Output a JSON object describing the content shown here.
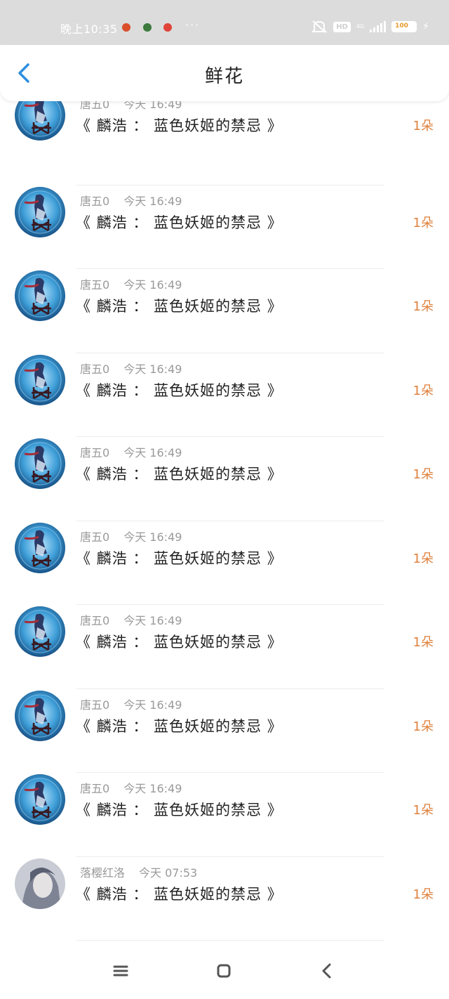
{
  "status_bar": {
    "time": "晚上10:35",
    "more": "···",
    "hd": "HD",
    "network": "4G",
    "battery": "100",
    "notification_colors": [
      "#d9502b",
      "#3c7a3e",
      "#e0443a"
    ]
  },
  "header": {
    "title": "鲜花",
    "back_icon": "chevron-left-icon",
    "accent_color": "#2f8ee0"
  },
  "entries": [
    {
      "user": "唐五0",
      "time": "今天 16:49",
      "book": "《 麟浩 ： 蓝色妖姬的禁忌 》",
      "count": "1朵",
      "avatar": "blue-swordsman"
    },
    {
      "user": "唐五0",
      "time": "今天 16:49",
      "book": "《 麟浩 ： 蓝色妖姬的禁忌 》",
      "count": "1朵",
      "avatar": "blue-swordsman"
    },
    {
      "user": "唐五0",
      "time": "今天 16:49",
      "book": "《 麟浩 ： 蓝色妖姬的禁忌 》",
      "count": "1朵",
      "avatar": "blue-swordsman"
    },
    {
      "user": "唐五0",
      "time": "今天 16:49",
      "book": "《 麟浩 ： 蓝色妖姬的禁忌 》",
      "count": "1朵",
      "avatar": "blue-swordsman"
    },
    {
      "user": "唐五0",
      "time": "今天 16:49",
      "book": "《 麟浩 ： 蓝色妖姬的禁忌 》",
      "count": "1朵",
      "avatar": "blue-swordsman"
    },
    {
      "user": "唐五0",
      "time": "今天 16:49",
      "book": "《 麟浩 ： 蓝色妖姬的禁忌 》",
      "count": "1朵",
      "avatar": "blue-swordsman"
    },
    {
      "user": "唐五0",
      "time": "今天 16:49",
      "book": "《 麟浩 ： 蓝色妖姬的禁忌 》",
      "count": "1朵",
      "avatar": "blue-swordsman"
    },
    {
      "user": "唐五0",
      "time": "今天 16:49",
      "book": "《 麟浩 ： 蓝色妖姬的禁忌 》",
      "count": "1朵",
      "avatar": "blue-swordsman"
    },
    {
      "user": "唐五0",
      "time": "今天 16:49",
      "book": "《 麟浩 ： 蓝色妖姬的禁忌 》",
      "count": "1朵",
      "avatar": "blue-swordsman"
    },
    {
      "user": "落樱红洛",
      "time": "今天 07:53",
      "book": "《 麟浩 ： 蓝色妖姬的禁忌 》",
      "count": "1朵",
      "avatar": "grey-portrait"
    }
  ],
  "colors": {
    "count": "#e0813c",
    "meta": "#9a9a9a",
    "status_bar_bg": "#dcdcdc"
  },
  "nav": {
    "menu_icon": "menu-icon",
    "home_icon": "home-icon",
    "back_icon": "back-icon"
  }
}
